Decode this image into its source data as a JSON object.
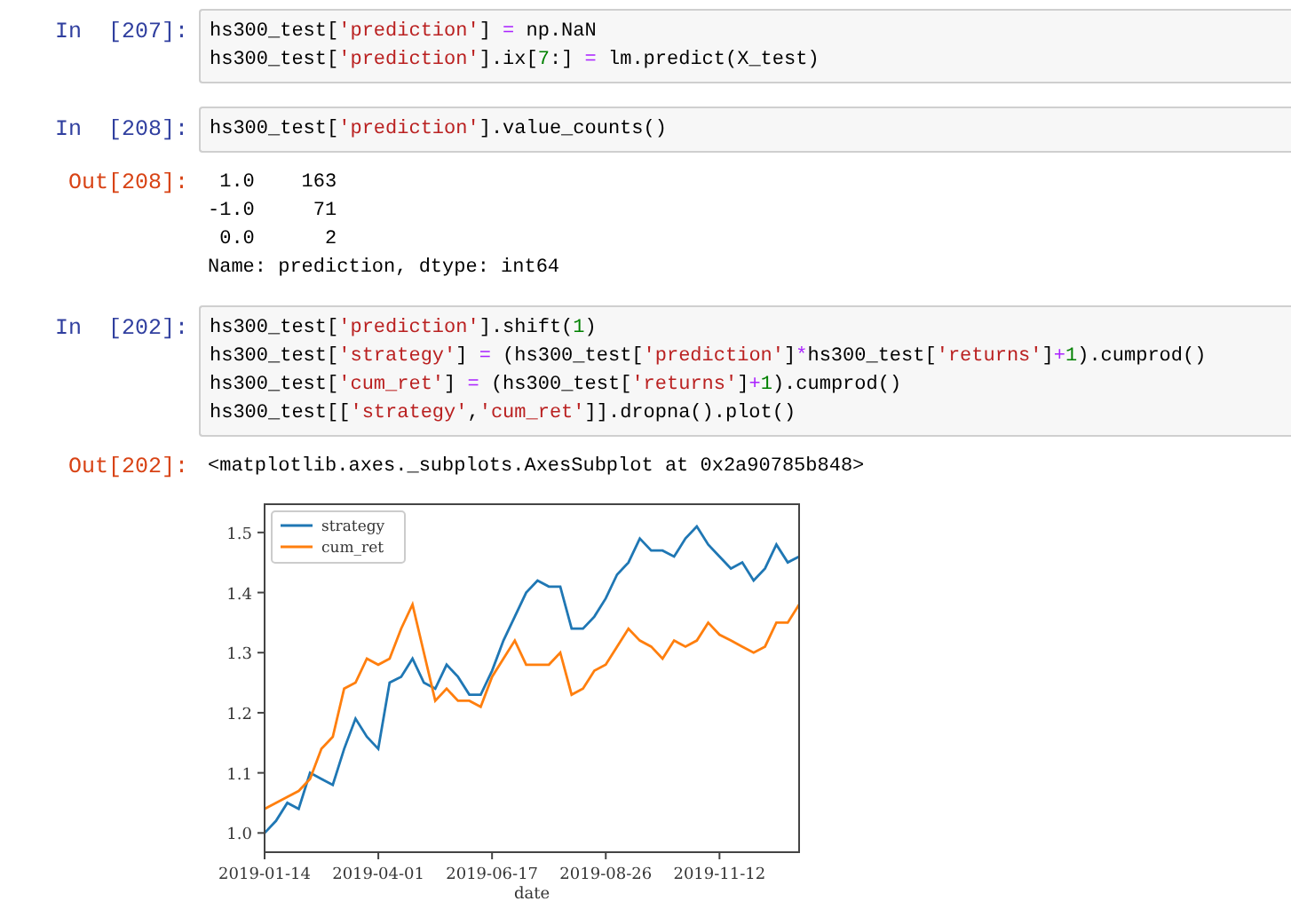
{
  "cells": [
    {
      "prompt": "In  [207]:",
      "kind": "input",
      "lines": [
        [
          {
            "t": "hs300_test[",
            "kind": "plain"
          },
          {
            "t": "'prediction'",
            "kind": "string"
          },
          {
            "t": "] ",
            "kind": "plain"
          },
          {
            "t": "=",
            "kind": "operator"
          },
          {
            "t": " np.NaN",
            "kind": "plain"
          }
        ],
        [
          {
            "t": "hs300_test[",
            "kind": "plain"
          },
          {
            "t": "'prediction'",
            "kind": "string"
          },
          {
            "t": "].ix[",
            "kind": "plain"
          },
          {
            "t": "7",
            "kind": "number"
          },
          {
            "t": ":] ",
            "kind": "plain"
          },
          {
            "t": "=",
            "kind": "operator"
          },
          {
            "t": " lm.predict(X_test)",
            "kind": "plain"
          }
        ]
      ]
    },
    {
      "prompt": "In  [208]:",
      "kind": "input",
      "lines": [
        [
          {
            "t": "hs300_test[",
            "kind": "plain"
          },
          {
            "t": "'prediction'",
            "kind": "string"
          },
          {
            "t": "].value_counts()",
            "kind": "plain"
          }
        ]
      ]
    },
    {
      "prompt": "Out[208]:",
      "kind": "output",
      "text": [
        " 1.0    163",
        "-1.0     71",
        " 0.0      2",
        "Name: prediction, dtype: int64"
      ]
    },
    {
      "prompt": "In  [202]:",
      "kind": "input",
      "lines": [
        [
          {
            "t": "hs300_test[",
            "kind": "plain"
          },
          {
            "t": "'prediction'",
            "kind": "string"
          },
          {
            "t": "].shift(",
            "kind": "plain"
          },
          {
            "t": "1",
            "kind": "number"
          },
          {
            "t": ")",
            "kind": "plain"
          }
        ],
        [
          {
            "t": "hs300_test[",
            "kind": "plain"
          },
          {
            "t": "'strategy'",
            "kind": "string"
          },
          {
            "t": "] ",
            "kind": "plain"
          },
          {
            "t": "=",
            "kind": "operator"
          },
          {
            "t": " (hs300_test[",
            "kind": "plain"
          },
          {
            "t": "'prediction'",
            "kind": "string"
          },
          {
            "t": "]",
            "kind": "plain"
          },
          {
            "t": "*",
            "kind": "operator"
          },
          {
            "t": "hs300_test[",
            "kind": "plain"
          },
          {
            "t": "'returns'",
            "kind": "string"
          },
          {
            "t": "]",
            "kind": "plain"
          },
          {
            "t": "+",
            "kind": "operator"
          },
          {
            "t": "1",
            "kind": "number"
          },
          {
            "t": ").cumprod()",
            "kind": "plain"
          }
        ],
        [
          {
            "t": "hs300_test[",
            "kind": "plain"
          },
          {
            "t": "'cum_ret'",
            "kind": "string"
          },
          {
            "t": "] ",
            "kind": "plain"
          },
          {
            "t": "=",
            "kind": "operator"
          },
          {
            "t": " (hs300_test[",
            "kind": "plain"
          },
          {
            "t": "'returns'",
            "kind": "string"
          },
          {
            "t": "]",
            "kind": "plain"
          },
          {
            "t": "+",
            "kind": "operator"
          },
          {
            "t": "1",
            "kind": "number"
          },
          {
            "t": ").cumprod()",
            "kind": "plain"
          }
        ],
        [
          {
            "t": "hs300_test[[",
            "kind": "plain"
          },
          {
            "t": "'strategy'",
            "kind": "string"
          },
          {
            "t": ",",
            "kind": "plain"
          },
          {
            "t": "'cum_ret'",
            "kind": "string"
          },
          {
            "t": "]].dropna().plot()",
            "kind": "plain"
          }
        ]
      ]
    },
    {
      "prompt": "Out[202]:",
      "kind": "output",
      "text": [
        "<matplotlib.axes._subplots.AxesSubplot at 0x2a90785b848>"
      ],
      "chart_data": {
        "type": "line",
        "xlabel": "date",
        "legend": "upper left",
        "categories": [
          "2019-01-14",
          null,
          null,
          null,
          null,
          null,
          null,
          null,
          null,
          null,
          "2019-04-01",
          null,
          null,
          null,
          null,
          null,
          null,
          null,
          null,
          null,
          "2019-06-17",
          null,
          null,
          null,
          null,
          null,
          null,
          null,
          null,
          null,
          "2019-08-26",
          null,
          null,
          null,
          null,
          null,
          null,
          null,
          null,
          null,
          "2019-11-12",
          null,
          null,
          null,
          null,
          null,
          null,
          null
        ],
        "series": [
          {
            "name": "strategy",
            "color": "#1f77b4",
            "values": [
              1.0,
              1.02,
              1.05,
              1.04,
              1.1,
              1.09,
              1.08,
              1.14,
              1.19,
              1.16,
              1.14,
              1.25,
              1.26,
              1.29,
              1.25,
              1.24,
              1.28,
              1.26,
              1.23,
              1.23,
              1.27,
              1.32,
              1.36,
              1.4,
              1.42,
              1.41,
              1.41,
              1.34,
              1.34,
              1.36,
              1.39,
              1.43,
              1.45,
              1.49,
              1.47,
              1.47,
              1.46,
              1.49,
              1.51,
              1.48,
              1.46,
              1.44,
              1.45,
              1.42,
              1.44,
              1.48,
              1.45,
              1.46
            ]
          },
          {
            "name": "cum_ret",
            "color": "#ff7f0e",
            "values": [
              1.04,
              1.05,
              1.06,
              1.07,
              1.09,
              1.14,
              1.16,
              1.24,
              1.25,
              1.29,
              1.28,
              1.29,
              1.34,
              1.38,
              1.3,
              1.22,
              1.24,
              1.22,
              1.22,
              1.21,
              1.26,
              1.29,
              1.32,
              1.28,
              1.28,
              1.28,
              1.3,
              1.23,
              1.24,
              1.27,
              1.28,
              1.31,
              1.34,
              1.32,
              1.31,
              1.29,
              1.32,
              1.31,
              1.32,
              1.35,
              1.33,
              1.32,
              1.31,
              1.3,
              1.31,
              1.35,
              1.35,
              1.38
            ]
          }
        ],
        "ylim": [
          0.968,
          1.547
        ],
        "yticks": [
          {
            "value": 1.0,
            "label": "1.0"
          },
          {
            "value": 1.1,
            "label": "1.1"
          },
          {
            "value": 1.2,
            "label": "1.2"
          },
          {
            "value": 1.3,
            "label": "1.3"
          },
          {
            "value": 1.4,
            "label": "1.4"
          },
          {
            "value": 1.5,
            "label": "1.5"
          }
        ]
      }
    }
  ]
}
